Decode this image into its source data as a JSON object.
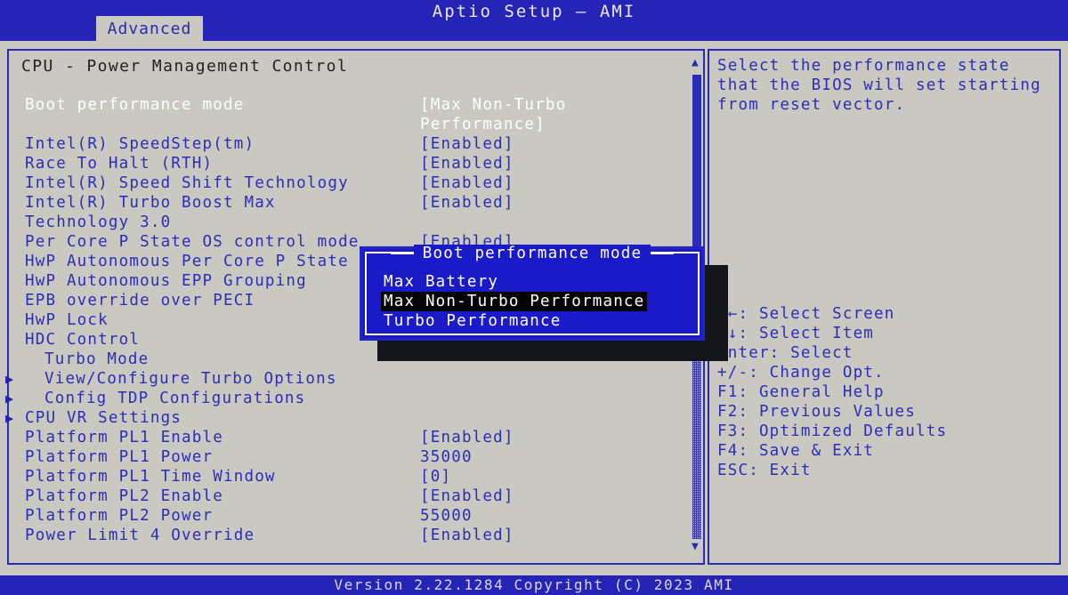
{
  "header": {
    "title": "Aptio Setup – AMI",
    "tabs": [
      {
        "label": "Advanced",
        "active": true
      }
    ]
  },
  "footer": {
    "version": "Version 2.22.1284 Copyright (C) 2023 AMI"
  },
  "main": {
    "panel_title": "CPU - Power Management Control",
    "rows": [
      {
        "label": "Boot performance mode",
        "value": "[Max Non-Turbo",
        "selected": true,
        "arrow": false,
        "indent": 0
      },
      {
        "label": "",
        "value": "Performance]",
        "selected": true,
        "arrow": false,
        "indent": 0
      },
      {
        "label": "Intel(R) SpeedStep(tm)",
        "value": "[Enabled]",
        "selected": false,
        "arrow": false,
        "indent": 0
      },
      {
        "label": "Race To Halt (RTH)",
        "value": "[Enabled]",
        "selected": false,
        "arrow": false,
        "indent": 0
      },
      {
        "label": "Intel(R) Speed Shift Technology",
        "value": "[Enabled]",
        "selected": false,
        "arrow": false,
        "indent": 0
      },
      {
        "label": "Intel(R) Turbo Boost Max",
        "value": "[Enabled]",
        "selected": false,
        "arrow": false,
        "indent": 0
      },
      {
        "label": "Technology 3.0",
        "value": "",
        "selected": false,
        "arrow": false,
        "indent": 0
      },
      {
        "label": "Per Core P State OS control mode",
        "value": "[Enabled]",
        "selected": false,
        "arrow": false,
        "indent": 0
      },
      {
        "label": "HwP Autonomous Per Core P State",
        "value": "",
        "selected": false,
        "arrow": false,
        "indent": 0
      },
      {
        "label": "HwP Autonomous EPP Grouping",
        "value": "",
        "selected": false,
        "arrow": false,
        "indent": 0
      },
      {
        "label": "EPB override over PECI",
        "value": "",
        "selected": false,
        "arrow": false,
        "indent": 0
      },
      {
        "label": "HwP Lock",
        "value": "",
        "selected": false,
        "arrow": false,
        "indent": 0
      },
      {
        "label": "HDC Control",
        "value": "",
        "selected": false,
        "arrow": false,
        "indent": 0
      },
      {
        "label": "Turbo Mode",
        "value": "",
        "selected": false,
        "arrow": false,
        "indent": 1
      },
      {
        "label": "View/Configure Turbo Options",
        "value": "",
        "selected": false,
        "arrow": true,
        "indent": 1
      },
      {
        "label": "Config TDP Configurations",
        "value": "",
        "selected": false,
        "arrow": true,
        "indent": 1
      },
      {
        "label": "CPU VR Settings",
        "value": "",
        "selected": false,
        "arrow": true,
        "indent": 0
      },
      {
        "label": "Platform PL1 Enable",
        "value": "[Enabled]",
        "selected": false,
        "arrow": false,
        "indent": 0
      },
      {
        "label": "Platform PL1 Power",
        "value": "35000",
        "selected": false,
        "arrow": false,
        "indent": 0
      },
      {
        "label": "Platform PL1 Time Window",
        "value": "[0]",
        "selected": false,
        "arrow": false,
        "indent": 0
      },
      {
        "label": "Platform PL2 Enable",
        "value": "[Enabled]",
        "selected": false,
        "arrow": false,
        "indent": 0
      },
      {
        "label": "Platform PL2 Power",
        "value": "55000",
        "selected": false,
        "arrow": false,
        "indent": 0
      },
      {
        "label": "Power Limit 4 Override",
        "value": "[Enabled]",
        "selected": false,
        "arrow": false,
        "indent": 0
      }
    ]
  },
  "scrollbar": {
    "up_icon": "▲",
    "down_icon": "▼"
  },
  "help": {
    "description": "Select the performance state that the BIOS will set starting from reset vector.",
    "keys": [
      "→←: Select Screen",
      "↑↓: Select Item",
      "Enter: Select",
      "+/-: Change Opt.",
      "F1: General Help",
      "F2: Previous Values",
      "F3: Optimized Defaults",
      "F4: Save & Exit",
      "ESC: Exit"
    ]
  },
  "dialog": {
    "title": "Boot performance mode",
    "options": [
      {
        "label": "Max Battery",
        "highlighted": false
      },
      {
        "label": "Max Non-Turbo Performance",
        "highlighted": true
      },
      {
        "label": "Turbo Performance",
        "highlighted": false
      }
    ]
  },
  "colors": {
    "screen_blue": "#2020b4",
    "panel_grey": "#c9c8c1",
    "text_blue": "#2d2db8",
    "text_white": "#ffffff",
    "dialog_blue": "#1a1ac8",
    "highlight_black": "#050507"
  }
}
